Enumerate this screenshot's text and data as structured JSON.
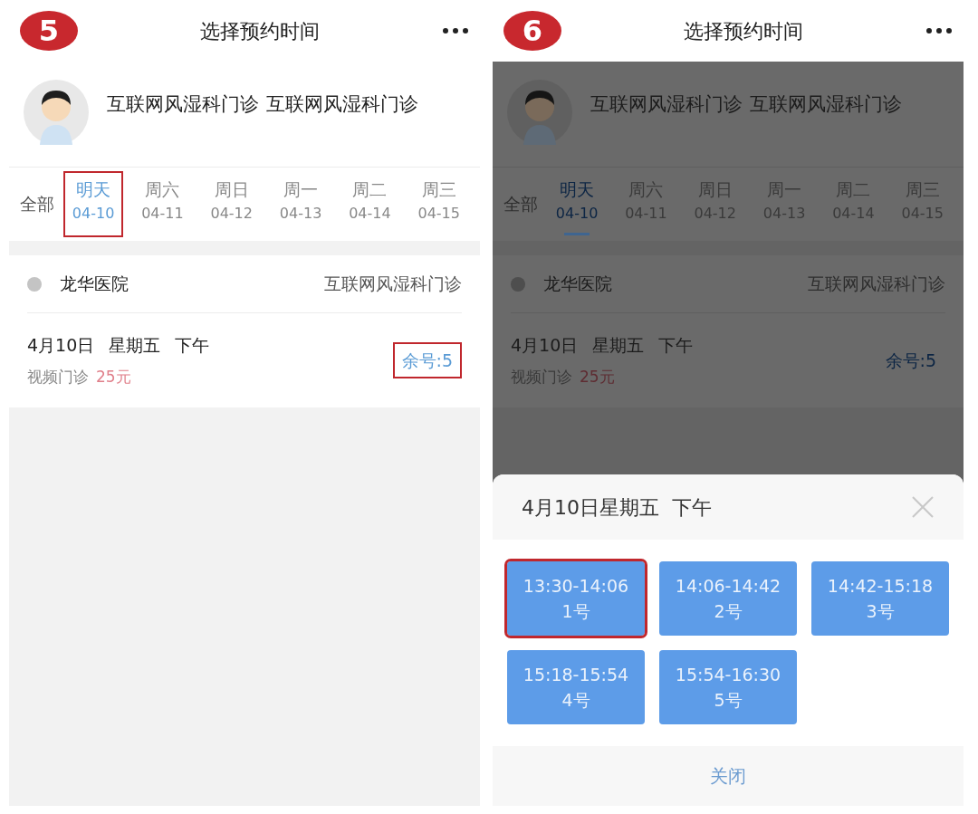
{
  "panels": [
    {
      "step": "5",
      "title": "选择预约时间",
      "dimmed": false,
      "doctor": {
        "name": "互联网风湿科门诊",
        "department": "互联网风湿科门诊"
      },
      "date_tabs": {
        "all_label": "全部",
        "tabs": [
          {
            "day": "明天",
            "date": "04-10",
            "selected": true,
            "highlighted": true
          },
          {
            "day": "周六",
            "date": "04-11",
            "selected": false,
            "highlighted": false
          },
          {
            "day": "周日",
            "date": "04-12",
            "selected": false,
            "highlighted": false
          },
          {
            "day": "周一",
            "date": "04-13",
            "selected": false,
            "highlighted": false
          },
          {
            "day": "周二",
            "date": "04-14",
            "selected": false,
            "highlighted": false
          },
          {
            "day": "周三",
            "date": "04-15",
            "selected": false,
            "highlighted": false
          }
        ]
      },
      "hospital": {
        "name": "龙华医院",
        "clinic": "互联网风湿科门诊"
      },
      "schedule": {
        "date": "4月10日",
        "weekday": "星期五",
        "period": "下午",
        "type": "视频门诊",
        "price": "25元",
        "remaining": "余号:5",
        "remaining_highlighted": true
      }
    },
    {
      "step": "6",
      "title": "选择预约时间",
      "dimmed": true,
      "doctor": {
        "name": "互联网风湿科门诊",
        "department": "互联网风湿科门诊"
      },
      "date_tabs": {
        "all_label": "全部",
        "tabs": [
          {
            "day": "明天",
            "date": "04-10",
            "selected": true,
            "highlighted": false
          },
          {
            "day": "周六",
            "date": "04-11",
            "selected": false,
            "highlighted": false
          },
          {
            "day": "周日",
            "date": "04-12",
            "selected": false,
            "highlighted": false
          },
          {
            "day": "周一",
            "date": "04-13",
            "selected": false,
            "highlighted": false
          },
          {
            "day": "周二",
            "date": "04-14",
            "selected": false,
            "highlighted": false
          },
          {
            "day": "周三",
            "date": "04-15",
            "selected": false,
            "highlighted": false
          }
        ]
      },
      "hospital": {
        "name": "龙华医院",
        "clinic": "互联网风湿科门诊"
      },
      "schedule": {
        "date": "4月10日",
        "weekday": "星期五",
        "period": "下午",
        "type": "视频门诊",
        "price": "25元",
        "remaining": "余号:5",
        "remaining_highlighted": false
      },
      "sheet": {
        "title": "4月10日星期五  下午",
        "close_label": "关闭",
        "slots": [
          {
            "time": "13:30-14:06",
            "number": "1号",
            "highlighted": true
          },
          {
            "time": "14:06-14:42",
            "number": "2号",
            "highlighted": false
          },
          {
            "time": "14:42-15:18",
            "number": "3号",
            "highlighted": false
          },
          {
            "time": "15:18-15:54",
            "number": "4号",
            "highlighted": false
          },
          {
            "time": "15:54-16:30",
            "number": "5号",
            "highlighted": false
          }
        ]
      }
    }
  ]
}
